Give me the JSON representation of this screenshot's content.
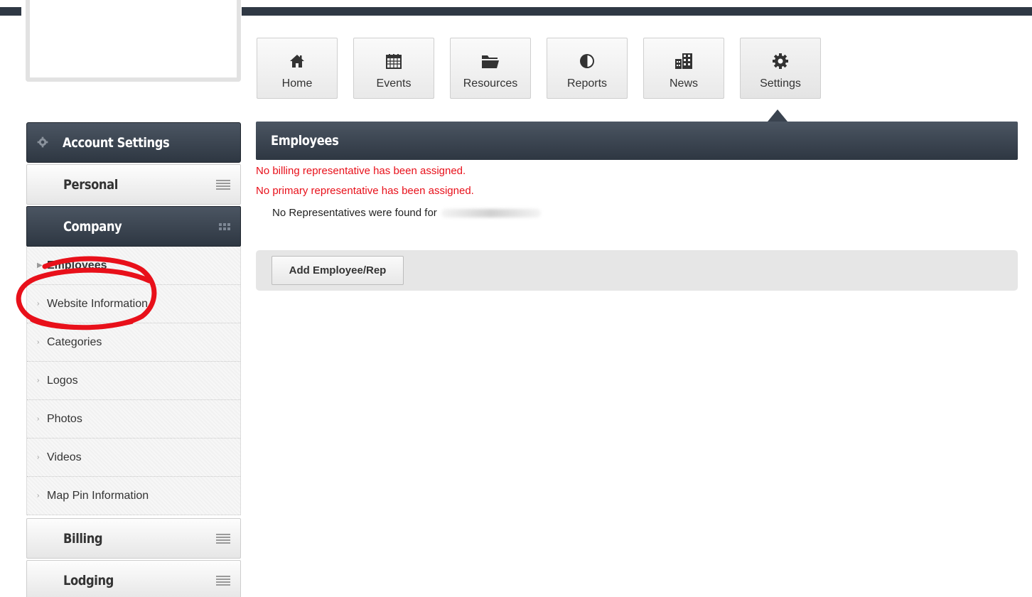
{
  "nav": {
    "items": [
      {
        "label": "Home",
        "icon": "home-icon"
      },
      {
        "label": "Events",
        "icon": "calendar-icon"
      },
      {
        "label": "Resources",
        "icon": "folder-icon"
      },
      {
        "label": "Reports",
        "icon": "pie-chart-icon"
      },
      {
        "label": "News",
        "icon": "building-icon"
      },
      {
        "label": "Settings",
        "icon": "gear-icon"
      }
    ],
    "active": "Settings"
  },
  "sidebar": {
    "title": "Account Settings",
    "sections": [
      {
        "label": "Personal"
      },
      {
        "label": "Company"
      },
      {
        "label": "Billing"
      },
      {
        "label": "Lodging"
      }
    ],
    "company_items": [
      {
        "label": "Employees"
      },
      {
        "label": "Website Information"
      },
      {
        "label": "Categories"
      },
      {
        "label": "Logos"
      },
      {
        "label": "Photos"
      },
      {
        "label": "Videos"
      },
      {
        "label": "Map Pin Information"
      }
    ]
  },
  "main": {
    "title": "Employees",
    "warnings": [
      "No billing representative has been assigned.",
      "No primary representative has been assigned."
    ],
    "no_reps_text": "No Representatives were found for",
    "add_button": "Add Employee/Rep"
  },
  "colors": {
    "header_dark": "#2f3844",
    "warning": "#e8101a",
    "annotation": "#e8101a"
  }
}
